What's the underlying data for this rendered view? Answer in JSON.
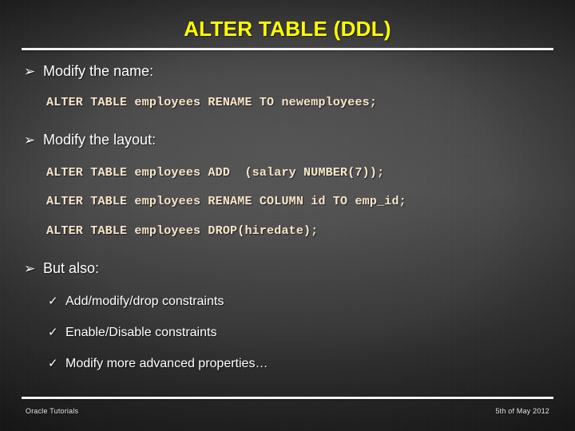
{
  "slide": {
    "title": "ALTER TABLE (DDL)",
    "title_color": "#FFFF00",
    "background_color": "#3A3A3A",
    "code_color": "#FAE7CA",
    "rule_color": "#F2F2F2",
    "body_text_color": "#FFFFFF"
  },
  "bullets": [
    {
      "marker": "➢",
      "label": "Modify the name:"
    },
    {
      "marker": "➢",
      "label": "Modify the layout:"
    },
    {
      "marker": "➢",
      "label": "But also:"
    }
  ],
  "code_blocks": [
    {
      "lines": [
        "ALTER TABLE employees RENAME TO newemployees;"
      ]
    },
    {
      "lines": [
        "ALTER TABLE employees ADD  (salary NUMBER(7));",
        "ALTER TABLE employees RENAME COLUMN id TO emp_id;",
        "ALTER TABLE employees DROP(hiredate);"
      ]
    }
  ],
  "sub_bullets": [
    {
      "marker": "✓",
      "label": "Add/modify/drop constraints"
    },
    {
      "marker": "✓",
      "label": "Enable/Disable constraints"
    },
    {
      "marker": "✓",
      "label": "Modify more advanced properties…"
    }
  ],
  "footer": {
    "left": "Oracle Tutorials",
    "right": "5th of May 2012"
  }
}
